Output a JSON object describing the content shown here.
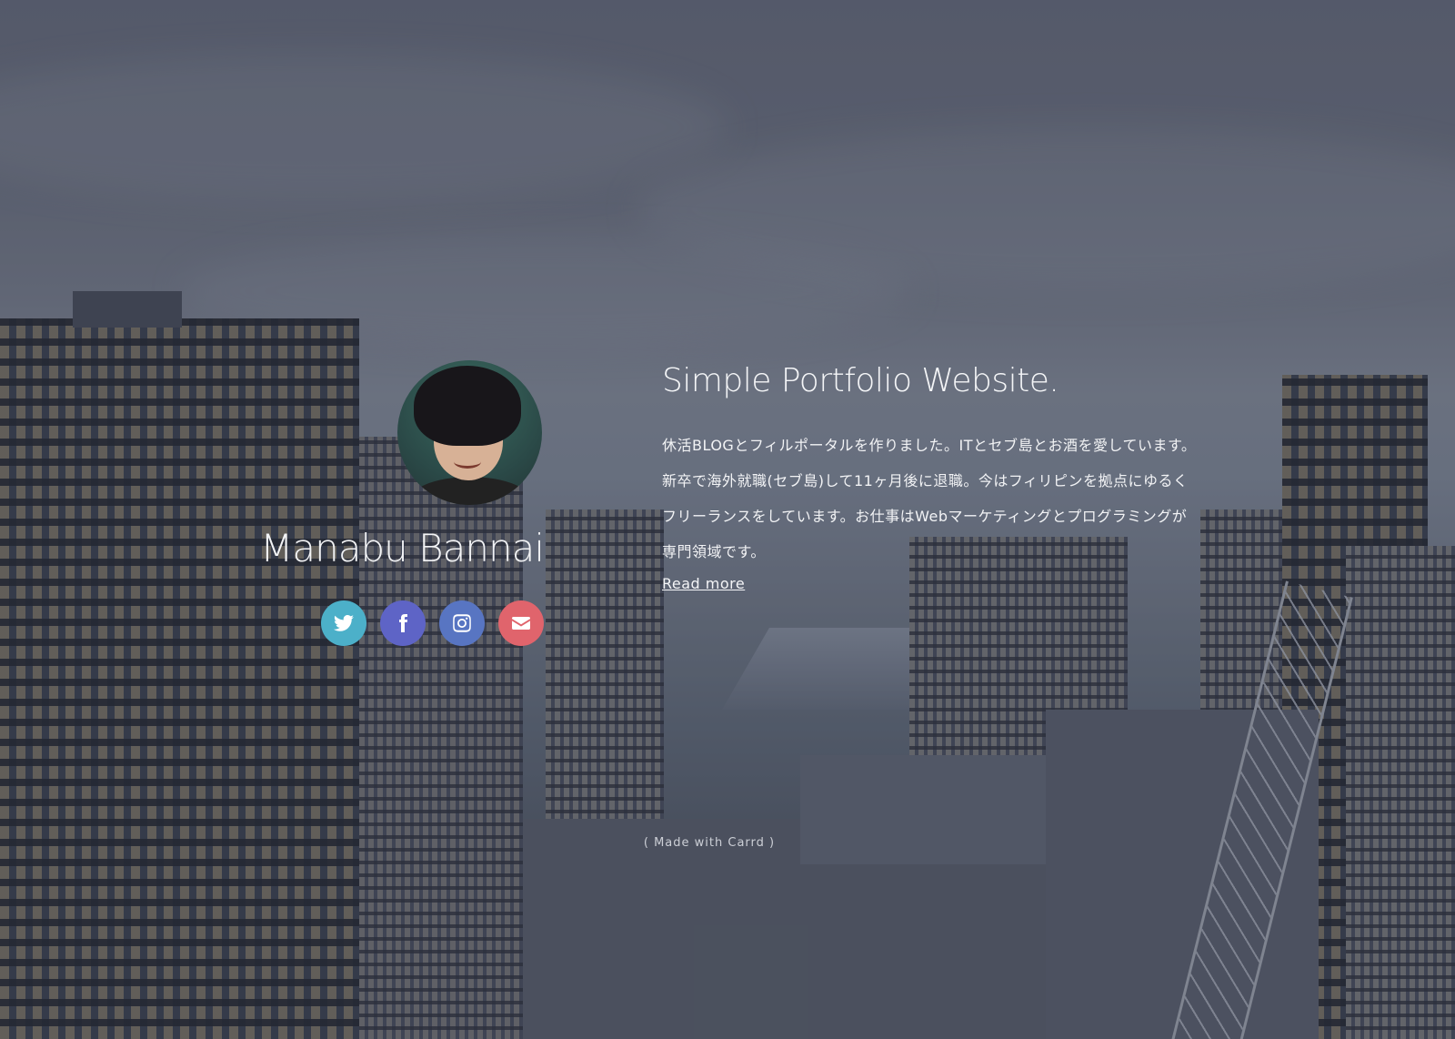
{
  "profile": {
    "name": "Manabu Bannai",
    "avatar_alt": "profile-photo"
  },
  "social_links": [
    {
      "icon": "twitter-icon",
      "color": "#4cb0c9"
    },
    {
      "icon": "facebook-icon",
      "color": "#5e64c6"
    },
    {
      "icon": "instagram-icon",
      "color": "#5875c2"
    },
    {
      "icon": "email-icon",
      "color": "#e0646c"
    }
  ],
  "main": {
    "headline": "Simple Portfolio Website.",
    "bio": "休活BLOGとフィルポータルを作りました。ITとセブ島とお酒を愛しています。新卒で海外就職(セブ島)して11ヶ月後に退職。今はフィリピンを拠点にゆるくフリーランスをしています。お仕事はWebマーケティングとプログラミングが専門領域です。",
    "read_more": "Read more"
  },
  "footer": {
    "credit": "( Made with Carrd )"
  },
  "colors": {
    "text": "#f2f3f5",
    "twitter": "#4cb0c9",
    "facebook": "#5e64c6",
    "instagram": "#5875c2",
    "email": "#e0646c"
  }
}
